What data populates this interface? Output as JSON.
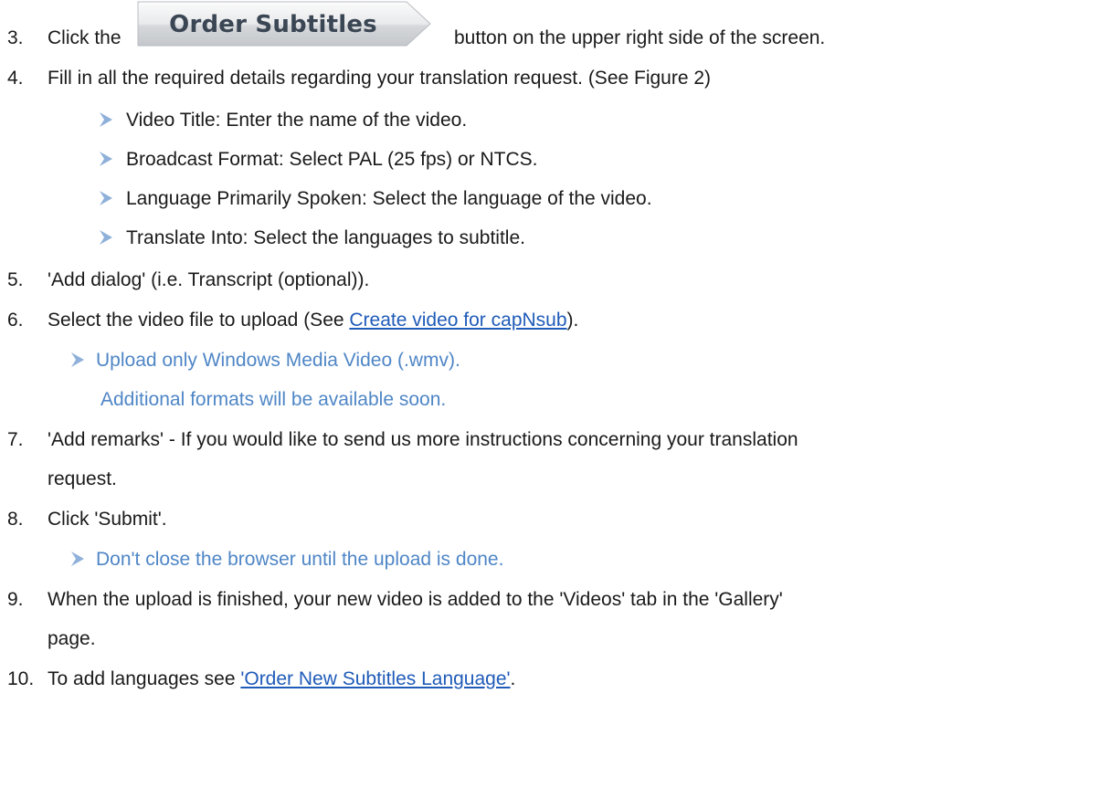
{
  "order_button": {
    "label": "Order Subtitles"
  },
  "steps": [
    {
      "num": "3.",
      "before": "Click the",
      "after": "button on the upper right side of the screen."
    },
    {
      "num": "4.",
      "text": "Fill in all the required details regarding your translation request. (See Figure 2)"
    },
    {
      "num": "5.",
      "text": "'Add dialog' (i.e. Transcript (optional))."
    },
    {
      "num": "6.",
      "before": "Select the video file to upload (See ",
      "link": "Create video for capNsub",
      "after": ")."
    },
    {
      "num": "7.",
      "text": "'Add remarks' - If you would like to send us more instructions concerning your translation",
      "text2": "request."
    },
    {
      "num": "8.",
      "text": "Click 'Submit'."
    },
    {
      "num": "9.",
      "text": "When the upload is finished, your new video is added to the 'Videos' tab in the 'Gallery'",
      "text2": "page."
    },
    {
      "num": "10.",
      "before": "To add languages see ",
      "link": "'Order New Subtitles Language'",
      "after": "."
    }
  ],
  "step4_bullets": [
    "Video Title: Enter the name of the video.",
    "Broadcast Format: Select PAL (25 fps) or NTCS.",
    "Language Primarily Spoken: Select the language of the video.",
    "Translate Into: Select the languages to subtitle."
  ],
  "step6_notes": {
    "bullet": "Upload only Windows Media Video (.wmv).",
    "continuation": "Additional formats will be available soon."
  },
  "step8_note": "Don't close the browser until the upload is done.",
  "colors": {
    "text": "#1a1a1a",
    "note_blue": "#4f86c6",
    "link": "#1f5bb8",
    "arrow": "#8fb0d9"
  }
}
